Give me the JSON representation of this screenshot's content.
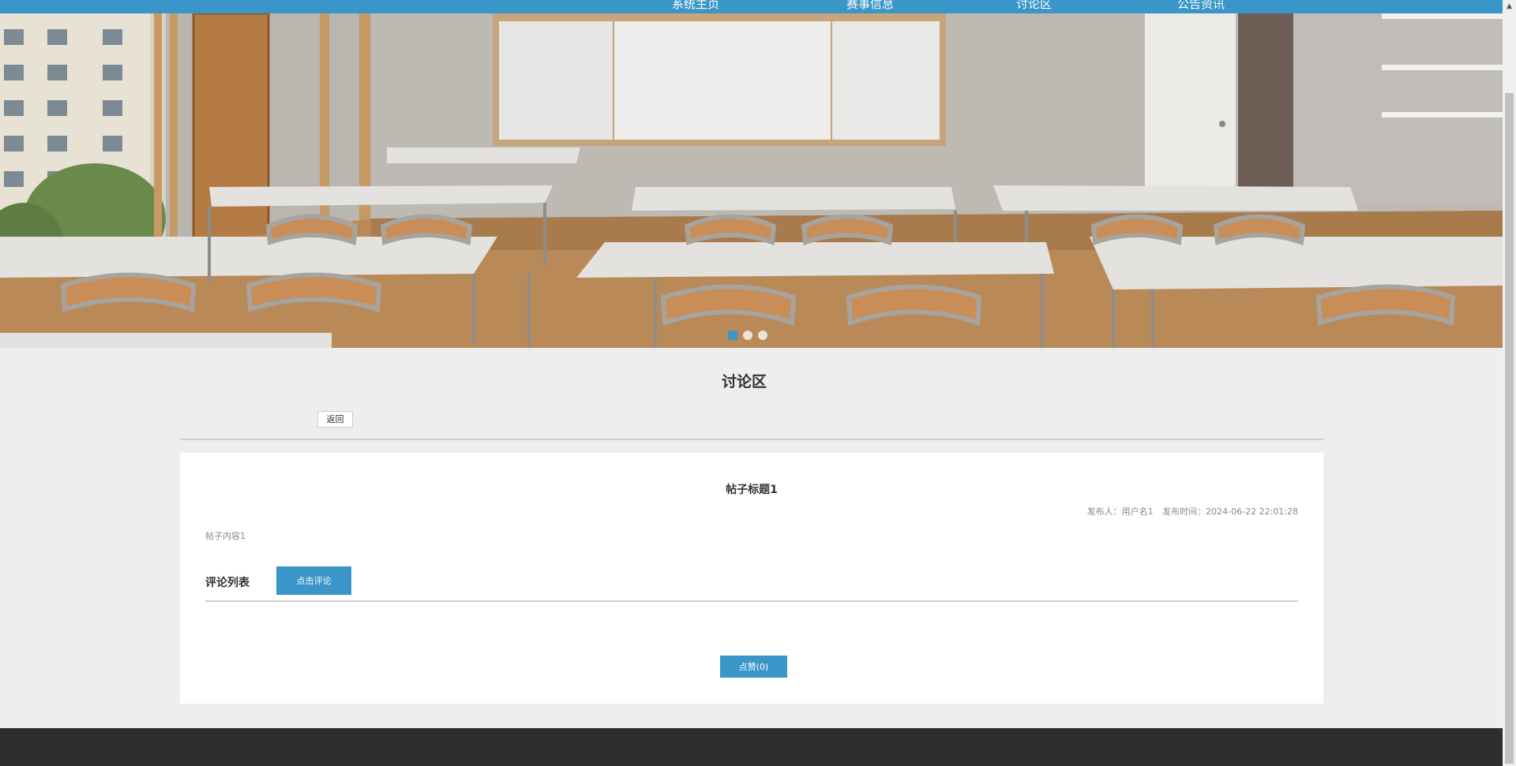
{
  "nav": {
    "items": [
      {
        "label": "系统主页"
      },
      {
        "label": "赛事信息"
      },
      {
        "label": "讨论区"
      },
      {
        "label": "公告资讯"
      }
    ]
  },
  "banner": {
    "image": "classroom-photo",
    "slides": 3,
    "active_slide": 1
  },
  "section": {
    "title": "讨论区",
    "back_label": "返回"
  },
  "post": {
    "title": "帖子标题1",
    "author_label": "发布人：用户名1",
    "time_label": "发布时间：2024-06-22 22:01:28",
    "content": "帖子内容1"
  },
  "comments": {
    "label": "评论列表",
    "add_label": "点击评论"
  },
  "like": {
    "label": "点赞(0)"
  },
  "colors": {
    "accent": "#3a95c8",
    "background": "#edeef0",
    "footer": "#2e2e2e"
  }
}
